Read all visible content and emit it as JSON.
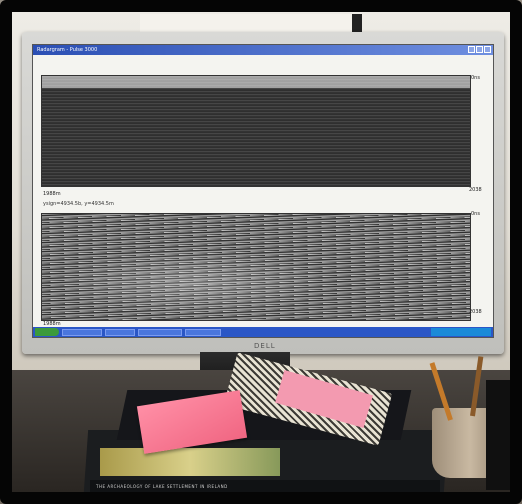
{
  "window": {
    "title": "Radargram - Pulse 3000"
  },
  "upper_panel": {
    "header_text": "",
    "right_top": "0ns",
    "right_bottom": "2038",
    "left_bottom": "1988m"
  },
  "lower_panel": {
    "header_text": "ysign=4934.5b, y=4934.5m",
    "right_top": "0ns",
    "right_bottom": "2038",
    "left_bottom": "1988m"
  },
  "monitor_brand": "DELL",
  "book_spine": "THE ARCHAEOLOGY OF LAKE SETTLEMENT IN IRELAND",
  "colors": {
    "screen_bg": "#f4f4f0",
    "radar_dark": "#1a1a1a",
    "taskbar": "#2a56c6",
    "sticky_note": "#f06682"
  }
}
